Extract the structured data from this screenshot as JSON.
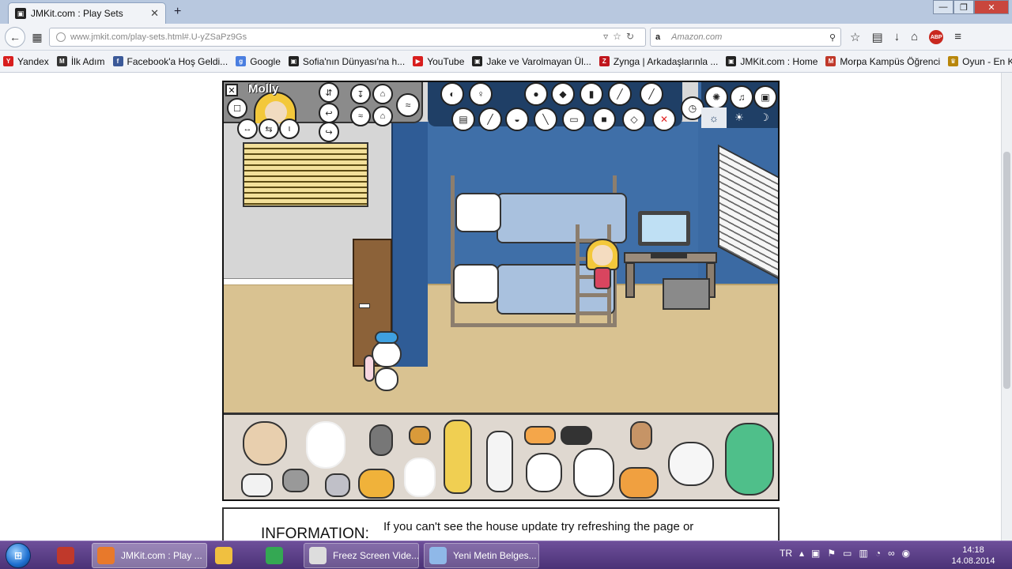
{
  "browser": {
    "tab_title": "JMKit.com : Play Sets",
    "tab_close": "✕",
    "new_tab": "+",
    "url": "www.jmkit.com/play-sets.html#.U-yZSaPz9Gs",
    "search_engine": "a",
    "search_placeholder": "Amazon.com",
    "abp_label": "ABP",
    "window_controls": [
      "—",
      "❐",
      "✕"
    ]
  },
  "bookmarks": [
    {
      "label": "Yandex",
      "icon": "Y",
      "color": "#d81e1e"
    },
    {
      "label": "İlk Adım",
      "icon": "M",
      "color": "#333333"
    },
    {
      "label": "Facebook'a Hoş Geldi...",
      "icon": "f",
      "color": "#3b5998"
    },
    {
      "label": "Google",
      "icon": "g",
      "color": "#4a7ee0"
    },
    {
      "label": "Sofia'nın Dünyası'na h...",
      "icon": "▣",
      "color": "#222222"
    },
    {
      "label": "YouTube",
      "icon": "▶",
      "color": "#d81e1e"
    },
    {
      "label": "Jake ve Varolmayan Ül...",
      "icon": "▣",
      "color": "#222222"
    },
    {
      "label": "Zynga | Arkadaşlarınla ...",
      "icon": "Z",
      "color": "#c0161d"
    },
    {
      "label": "JMKit.com : Home",
      "icon": "▣",
      "color": "#222222"
    },
    {
      "label": "Morpa Kampüs Öğrenci",
      "icon": "M",
      "color": "#c0392b"
    },
    {
      "label": "Oyun - En Kral Oyunla...",
      "icon": "♛",
      "color": "#b8860b"
    }
  ],
  "game": {
    "character_name": "Molly",
    "close_label": "✕",
    "left_tools": [
      "☐",
      "↔",
      "⇆",
      "ι",
      "⇵",
      "↩",
      "↪",
      "↧",
      "⌂",
      "≈"
    ],
    "top_tools": [
      "◐",
      "♀",
      "●",
      "◆",
      "▮",
      "╱",
      "╱",
      "▤",
      "╱",
      "◒",
      "╲",
      "▭",
      "■",
      "◇",
      "✕"
    ],
    "right_tools": [
      "✺",
      "♫",
      "▣"
    ],
    "time_of_day": [
      "☼",
      "☀",
      "☽"
    ]
  },
  "info": {
    "label": "INFORMATION:",
    "text": "If you can't see the house update try refreshing the page or"
  },
  "taskbar": {
    "buttons": [
      {
        "label": "",
        "color": "#c0392b"
      },
      {
        "label": "JMKit.com : Play ...",
        "color": "#e8792b"
      },
      {
        "label": "",
        "color": "#f0c040"
      },
      {
        "label": "",
        "color": "#34a853"
      },
      {
        "label": "Freez Screen Vide...",
        "color": "#dddddd"
      },
      {
        "label": "Yeni Metin Belges...",
        "color": "#8fb8e8"
      }
    ],
    "lang": "TR",
    "time": "14:18",
    "date": "14.08.2014"
  }
}
